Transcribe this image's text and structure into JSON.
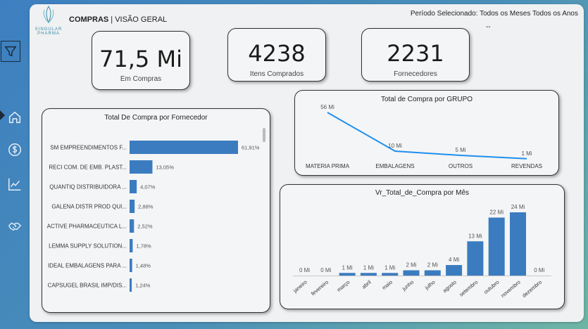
{
  "header": {
    "logo_text": "SINGULAR PHARMA",
    "title_bold": "COMPRAS",
    "title_rest": " | VISÃO GERAL",
    "period": "Período Selecionado: Todos os Meses Todos os Anos",
    "period_sub": "--"
  },
  "sidebar": {
    "items": [
      {
        "icon": "filter-icon"
      },
      {
        "icon": "home-icon"
      },
      {
        "icon": "dollar-icon"
      },
      {
        "icon": "line-chart-icon"
      },
      {
        "icon": "handshake-icon"
      }
    ]
  },
  "kpis": {
    "compras": {
      "value": "71,5 Mi",
      "label": "Em Compras"
    },
    "itens": {
      "value": "4238",
      "label": "Itens Comprados"
    },
    "fornecedores": {
      "value": "2231",
      "label": "Fornecedores"
    }
  },
  "colors": {
    "bar": "#3b7cc0",
    "line": "#1f8fef"
  },
  "chart_data": [
    {
      "type": "bar",
      "orientation": "horizontal",
      "title": "Total De Compra por Fornecedor",
      "categories": [
        "SM EMPREENDIMENTOS F...",
        "RECI COM. DE EMB. PLAST...",
        "QUANTIQ DISTRIBUIDORA ...",
        "GALENA DISTR PROD QUI...",
        "ACTIVE PHARMACEUTICA L...",
        "LEMMA SUPPLY SOLUTION...",
        "IDEAL EMBALAGENS PARA ...",
        "CAPSUGEL BRASIL IMP/DIS..."
      ],
      "values": [
        61.91,
        13.05,
        4.07,
        2.88,
        2.52,
        1.78,
        1.48,
        1.24
      ],
      "labels": [
        "61,91%",
        "13,05%",
        "4,07%",
        "2,88%",
        "2,52%",
        "1,78%",
        "1,48%",
        "1,24%"
      ]
    },
    {
      "type": "line",
      "title": "Total de Compra por GRUPO",
      "categories": [
        "MATERIA PRIMA",
        "EMBALAGENS",
        "OUTROS",
        "REVENDAS"
      ],
      "values": [
        56,
        10,
        5,
        1
      ],
      "labels": [
        "56 Mi",
        "10 Mi",
        "5 Mi",
        "1 Mi"
      ]
    },
    {
      "type": "bar",
      "title": "Vr_Total_de_Compra por Mês",
      "categories": [
        "janeiro",
        "fevereiro",
        "março",
        "abril",
        "maio",
        "junho",
        "julho",
        "agosto",
        "setembro",
        "outubro",
        "novembro",
        "dezembro"
      ],
      "values": [
        0,
        0,
        1,
        1,
        1,
        2,
        2,
        4,
        13,
        22,
        24,
        0
      ],
      "labels": [
        "0 Mi",
        "0 Mi",
        "1 Mi",
        "1 Mi",
        "1 Mi",
        "2 Mi",
        "2 Mi",
        "4 Mi",
        "13 Mi",
        "22 Mi",
        "24 Mi",
        "0 Mi"
      ]
    }
  ]
}
